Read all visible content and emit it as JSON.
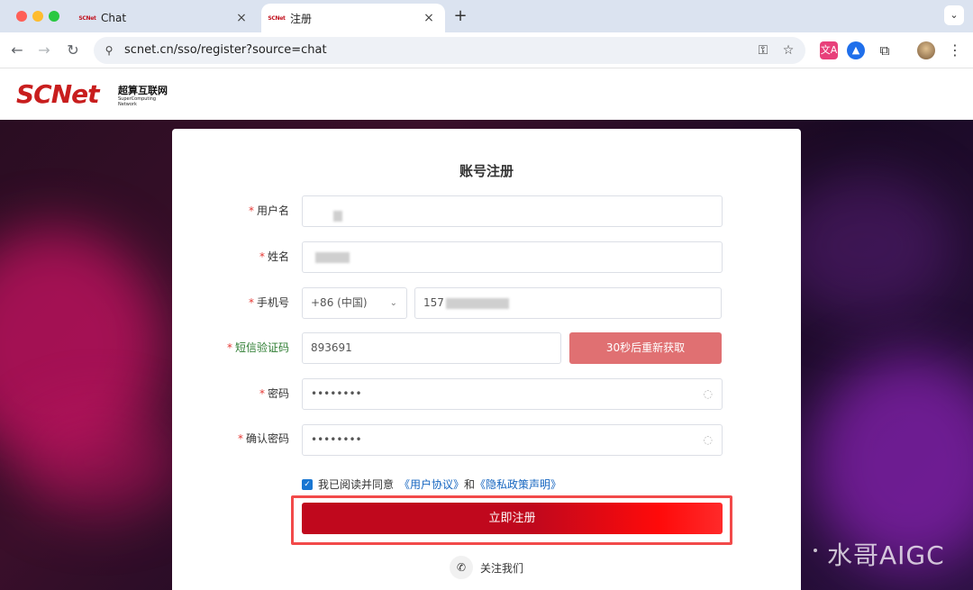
{
  "browser": {
    "tabs": [
      {
        "favicon": "SCNet",
        "title": "Chat",
        "close": "×"
      },
      {
        "favicon": "SCNet",
        "title": "注册",
        "close": "×"
      }
    ],
    "new_tab": "+",
    "tab_menu": "⌄",
    "nav": {
      "back": "←",
      "forward": "→",
      "reload": "↻"
    },
    "site_info_icon": "⚲",
    "url": "scnet.cn/sso/register?source=chat",
    "omnibox_icons": {
      "key": "⚿",
      "star": "☆"
    },
    "extensions": {
      "translate": "文A",
      "blue": "▲",
      "puzzle": "⧉"
    },
    "kebab": "⋮"
  },
  "header": {
    "logo_text": "SCNet",
    "logo_cn": "超算互联网",
    "logo_en": "SuperComputing Network"
  },
  "form": {
    "title": "账号注册",
    "required_mark": "*",
    "labels": {
      "username": "用户名",
      "name": "姓名",
      "phone": "手机号",
      "sms_code": "短信验证码",
      "password": "密码",
      "confirm_password": "确认密码"
    },
    "values": {
      "country_code": "+86 (中国)",
      "phone_prefix": "157",
      "sms_code": "893691",
      "password": "••••••••",
      "confirm_password": "••••••••"
    },
    "icons": {
      "caret": "⌄",
      "eye": "◌"
    },
    "sms_button": "30秒后重新获取",
    "agree": {
      "check": "✓",
      "text": "我已阅读并同意",
      "user_agreement": "《用户协议》",
      "and": "和",
      "privacy": "《隐私政策声明》"
    },
    "submit": "立即注册",
    "follow": {
      "icon": "✆",
      "label": "关注我们"
    }
  },
  "watermark": "水哥AIGC",
  "colors": {
    "brand_red": "#c81e1e",
    "sms_button": "#e07072",
    "submit_start": "#c0081d",
    "submit_end": "#ff2a2a",
    "highlight": "#f24a4a",
    "link": "#1565c0"
  }
}
